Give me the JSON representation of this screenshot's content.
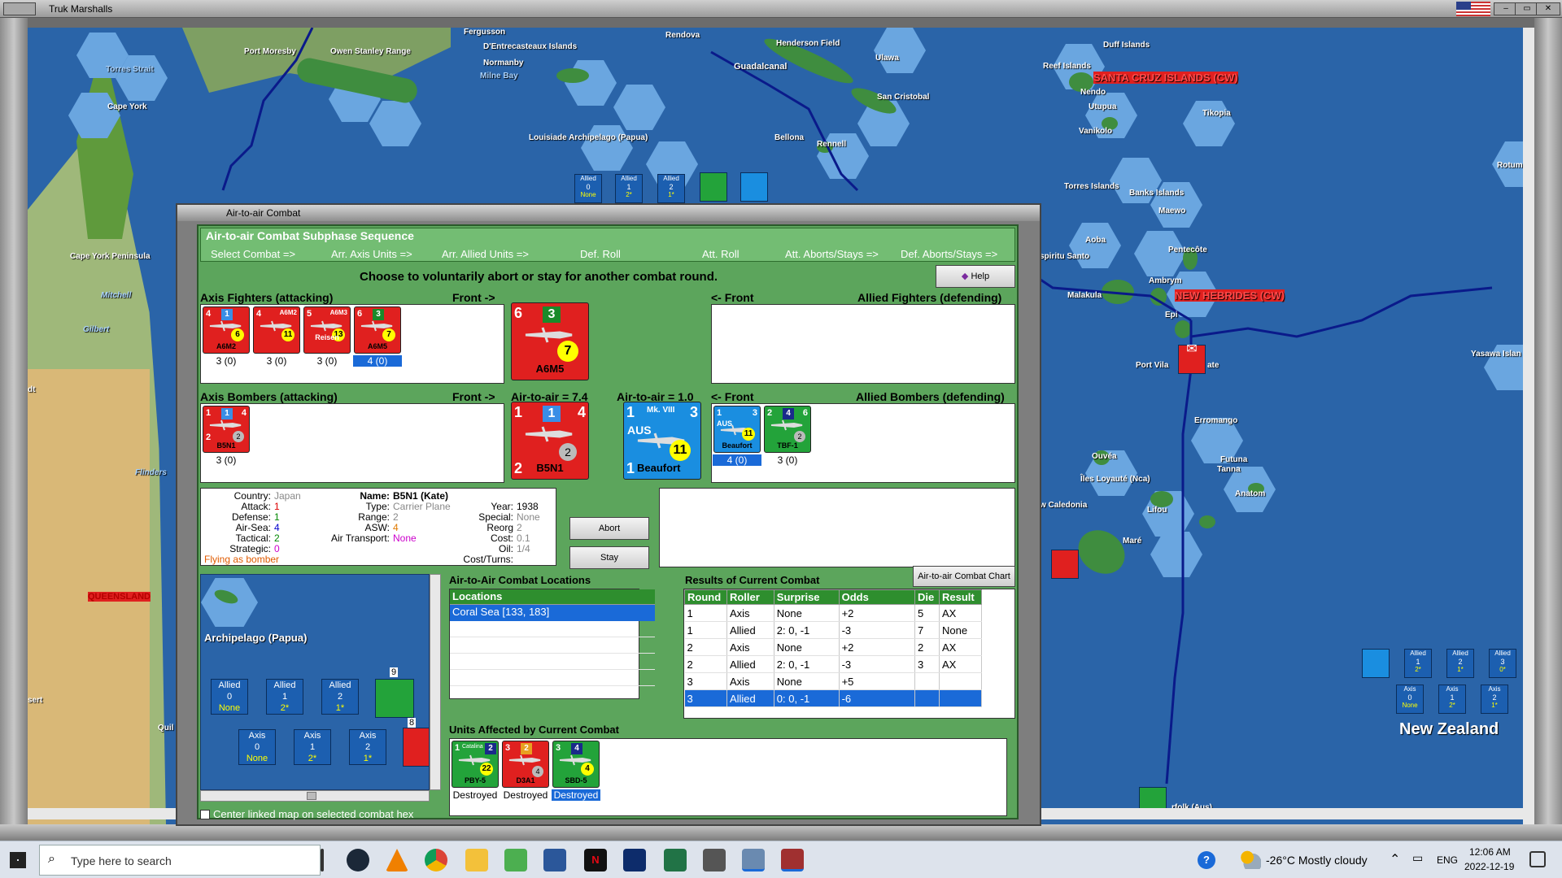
{
  "window": {
    "title": "Truk Marshalls"
  },
  "map": {
    "labels": [
      {
        "text": "Port Moresby",
        "red": false
      },
      {
        "text": "Owen Stanley Range",
        "red": false
      },
      {
        "text": "Fergusson",
        "red": false
      },
      {
        "text": "D'Entrecasteaux Islands",
        "red": false
      },
      {
        "text": "Normanby",
        "red": false
      },
      {
        "text": "Milne Bay",
        "red": false
      },
      {
        "text": "Rendova",
        "red": false
      },
      {
        "text": "Henderson Field",
        "red": false
      },
      {
        "text": "Guadalcanal",
        "red": false
      },
      {
        "text": "Ulawa",
        "red": false
      },
      {
        "text": "San Cristobal",
        "red": false
      },
      {
        "text": "Duff Islands",
        "red": false
      },
      {
        "text": "Reef Islands",
        "red": false
      },
      {
        "text": "Nendo",
        "red": false
      },
      {
        "text": "Utupua",
        "red": false
      },
      {
        "text": "Vanikolo",
        "red": false
      },
      {
        "text": "Tikopia",
        "red": false
      },
      {
        "text": "SANTA CRUZ ISLANDS (CW)",
        "red": true
      },
      {
        "text": "Torres Strait",
        "red": false
      },
      {
        "text": "Cape York",
        "red": false
      },
      {
        "text": "Louisiade Archipelago (Papua)",
        "red": false
      },
      {
        "text": "Bellona",
        "red": false
      },
      {
        "text": "Rennell",
        "red": false
      },
      {
        "text": "Torres Islands",
        "red": false
      },
      {
        "text": "Banks Islands",
        "red": false
      },
      {
        "text": "Maewo",
        "red": false
      },
      {
        "text": "Aoba",
        "red": false
      },
      {
        "text": "Pentecôte",
        "red": false
      },
      {
        "text": "spiritu Santo",
        "red": false
      },
      {
        "text": "Malakula",
        "red": false
      },
      {
        "text": "Ambrym",
        "red": false
      },
      {
        "text": "NEW HEBRIDES (CW)",
        "red": true
      },
      {
        "text": "Epi",
        "red": false
      },
      {
        "text": "Port Vila",
        "red": false
      },
      {
        "text": "Cape York Peninsula",
        "red": false
      },
      {
        "text": "Mitchell",
        "red": false
      },
      {
        "text": "Gilbert",
        "red": false
      },
      {
        "text": "Flinders",
        "red": false
      },
      {
        "text": "QUEENSLAND",
        "red": true
      },
      {
        "text": "Erromango",
        "red": false
      },
      {
        "text": "Ouvéa",
        "red": false
      },
      {
        "text": "Îles Loyauté (Nca)",
        "red": false
      },
      {
        "text": "Futuna",
        "red": false
      },
      {
        "text": "Tanna",
        "red": false
      },
      {
        "text": "Anatom",
        "red": false
      },
      {
        "text": "Lifou",
        "red": false
      },
      {
        "text": "Maré",
        "red": false
      },
      {
        "text": "w Caledonia",
        "red": false
      },
      {
        "text": "Yasawa Islan",
        "red": false
      },
      {
        "text": "Rotum",
        "red": false
      },
      {
        "text": "New Zealand",
        "red": false
      },
      {
        "text": "rfolk (Aus)",
        "red": false
      },
      {
        "text": "ate",
        "red": false
      },
      {
        "text": "dt",
        "red": false
      },
      {
        "text": "sert",
        "red": false
      },
      {
        "text": "Quil",
        "red": false
      }
    ],
    "top_counters": [
      {
        "side": "Allied",
        "num": "0",
        "sub": "None"
      },
      {
        "side": "Allied",
        "num": "1",
        "sub": "2*"
      },
      {
        "side": "Allied",
        "num": "2",
        "sub": "1*"
      }
    ],
    "right_counters_top": [
      {
        "side": "Allied",
        "num": "1",
        "sub": "2*"
      },
      {
        "side": "Allied",
        "num": "2",
        "sub": "1*"
      },
      {
        "side": "Allied",
        "num": "3",
        "sub": "0*"
      }
    ],
    "right_counters_bottom": [
      {
        "side": "Axis",
        "num": "0",
        "sub": "None"
      },
      {
        "side": "Axis",
        "num": "1",
        "sub": "2*"
      },
      {
        "side": "Axis",
        "num": "2",
        "sub": "1*"
      }
    ]
  },
  "dialog": {
    "title": "Air-to-air Combat",
    "sequence_title": "Air-to-air Combat Subphase Sequence",
    "steps": [
      "Select Combat =>",
      "Arr. Axis Units =>",
      "Arr. Allied Units =>",
      "Def. Roll",
      "Att. Roll",
      "Att. Aborts/Stays =>",
      "Def. Aborts/Stays =>"
    ],
    "instruction": "Choose to voluntarily abort or stay for another combat round.",
    "help_label": "Help",
    "axis_fighters_label": "Axis Fighters (attacking)",
    "front_right": "Front ->",
    "front_left": "<- Front",
    "allied_fighters_label": "Allied Fighters (defending)",
    "axis_bombers_label": "Axis Bombers (attacking)",
    "allied_bombers_label": "Allied Bombers (defending)",
    "air_to_air_axis": "Air-to-air = 7.4",
    "air_to_air_allied": "Air-to-air = 1.0",
    "axis_fighters": [
      {
        "name": "A6M2",
        "tl": "4",
        "tr": "",
        "sq": "1",
        "badge": "6",
        "label": "3 (0)",
        "selected": false
      },
      {
        "name": "A6M2",
        "tl": "4",
        "tr": "A6M2",
        "sq": "",
        "badge": "11",
        "label": "3 (0)",
        "selected": false
      },
      {
        "name": "Reisen",
        "tl": "5",
        "tr": "A6M3",
        "sq": "",
        "badge": "13",
        "label": "3 (0)",
        "selected": false
      },
      {
        "name": "A6M5",
        "tl": "6",
        "tr": "",
        "sq": "3",
        "badge": "7",
        "label": "4 (0)",
        "selected": true
      }
    ],
    "big_axis_fighter": {
      "tl": "6",
      "sq": "3",
      "badge": "7",
      "name": "A6M5"
    },
    "axis_bombers": [
      {
        "name": "B5N1",
        "tl": "1",
        "tr": "4",
        "bl": "2",
        "sq": "1",
        "gray": "2",
        "label": "3 (0)"
      }
    ],
    "big_axis_bomber": {
      "tl": "1",
      "tr": "4",
      "bl": "2",
      "sq": "1",
      "gray": "2",
      "name": "B5N1"
    },
    "big_allied_bomber": {
      "tl": "1",
      "tr": "3",
      "bl": "1",
      "mk": "Mk. VIII",
      "nat": "AUS",
      "badge": "11",
      "name": "Beaufort"
    },
    "allied_bombers": [
      {
        "name": "Beaufort",
        "nat": "AUS",
        "tl": "1",
        "tr": "3",
        "badge": "11",
        "label": "4 (0)",
        "selected": true,
        "color": "blue"
      },
      {
        "name": "TBF-1",
        "nat": "",
        "tl": "2",
        "tr": "6",
        "sq": "4",
        "gray": "2",
        "label": "3 (0)",
        "selected": false,
        "color": "green"
      }
    ],
    "info": {
      "country_k": "Country:",
      "country": "Japan",
      "attack_k": "Attack:",
      "attack": "1",
      "defense_k": "Defense:",
      "defense": "1",
      "airsea_k": "Air-Sea:",
      "airsea": "4",
      "tactical_k": "Tactical:",
      "tactical": "2",
      "strategic_k": "Strategic:",
      "strategic": "0",
      "flying": "Flying as bomber",
      "name_k": "Name:",
      "name": "B5N1 (Kate)",
      "type_k": "Type:",
      "type": "Carrier Plane",
      "year_k": "Year:",
      "year": "1938",
      "range_k": "Range:",
      "range": "2",
      "special_k": "Special:",
      "special": "None",
      "asw_k": "ASW:",
      "asw": "4",
      "reorg_k": "Reorg Cost:",
      "reorg": "2",
      "airtransport_k": "Air Transport:",
      "airtransport": "None",
      "oil_k": "Oil:",
      "oil": "0.1",
      "cost_k": "Cost/Turns:",
      "cost": "1/4"
    },
    "abort_label": "Abort",
    "stay_label": "Stay",
    "minimap": {
      "label": "Archipelago (Papua)",
      "allied": [
        {
          "side": "Allied",
          "num": "0",
          "sub": "None"
        },
        {
          "side": "Allied",
          "num": "1",
          "sub": "2*"
        },
        {
          "side": "Allied",
          "num": "2",
          "sub": "1*"
        }
      ],
      "axis": [
        {
          "side": "Axis",
          "num": "0",
          "sub": "None"
        },
        {
          "side": "Axis",
          "num": "1",
          "sub": "2*"
        },
        {
          "side": "Axis",
          "num": "2",
          "sub": "1*"
        }
      ],
      "stack_top": "9",
      "stack_bottom": "8"
    },
    "center_linked_label": "Center linked map on selected combat hex",
    "locations_title": "Air-to-Air Combat Locations",
    "locations_header": "Locations",
    "locations": [
      "Coral Sea [133, 183]"
    ],
    "results_title": "Results of Current Combat",
    "chart_button": "Air-to-air Combat Chart",
    "results_headers": [
      "Round",
      "Roller",
      "Surprise",
      "Odds",
      "Die",
      "Result"
    ],
    "results_rows": [
      {
        "cells": [
          "1",
          "Axis",
          "None",
          "+2",
          "5",
          "AX"
        ],
        "selected": false
      },
      {
        "cells": [
          "1",
          "Allied",
          "2: 0, -1",
          "-3",
          "7",
          "None"
        ],
        "selected": false
      },
      {
        "cells": [
          "2",
          "Axis",
          "None",
          "+2",
          "2",
          "AX"
        ],
        "selected": false
      },
      {
        "cells": [
          "2",
          "Allied",
          "2: 0, -1",
          "-3",
          "3",
          "AX"
        ],
        "selected": false
      },
      {
        "cells": [
          "3",
          "Axis",
          "None",
          "+5",
          "",
          ""
        ],
        "selected": false
      },
      {
        "cells": [
          "3",
          "Allied",
          "0: 0, -1",
          "-6",
          "",
          ""
        ],
        "selected": true
      }
    ],
    "affected_title": "Units Affected by Current Combat",
    "affected": [
      {
        "name": "PBY-5",
        "top": "Catalina",
        "tl": "1",
        "sq": "2",
        "badge": "22",
        "color": "green",
        "status": "Destroyed",
        "selected": false
      },
      {
        "name": "D3A1",
        "top": "",
        "tl": "3",
        "sq": "2",
        "gray": "4",
        "color": "red",
        "status": "Destroyed",
        "selected": false
      },
      {
        "name": "SBD-5",
        "top": "",
        "tl": "3",
        "sq": "4",
        "badge": "4",
        "color": "green",
        "status": "Destroyed",
        "selected": true
      }
    ]
  },
  "taskbar": {
    "search_placeholder": "Type here to search",
    "weather": "-26°C  Mostly cloudy",
    "lang": "ENG",
    "time": "12:06 AM",
    "date": "2022-12-19"
  }
}
